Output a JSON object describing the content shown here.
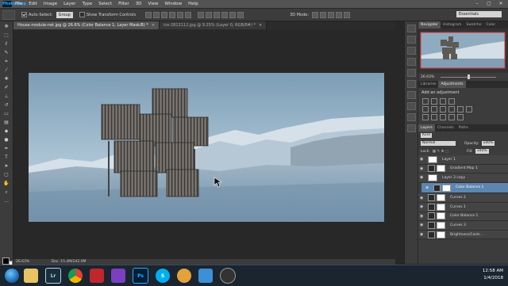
{
  "app": "Photoshop",
  "menu": [
    "File",
    "Edit",
    "Image",
    "Layer",
    "Type",
    "Select",
    "Filter",
    "3D",
    "View",
    "Window",
    "Help"
  ],
  "options": {
    "auto_select": "Auto-Select:",
    "auto_select_target": "Group",
    "transform_controls": "Show Transform Controls",
    "mode_3d": "3D Mode:",
    "workspace": "Essentials"
  },
  "tabs": [
    {
      "label": "House module-net.jpg @ 26.6% (Color Balance 1, Layer Mask/8) *",
      "close": "×"
    },
    {
      "label": "ice-2813112.jpg @ 9.25% (Layer 0, RGB/8#) *",
      "close": "×"
    }
  ],
  "status": {
    "zoom": "26.63%",
    "doc": "Doc: 15.4M/242.0M"
  },
  "navigator": {
    "tabs": [
      "Navigator",
      "Histogram",
      "Swatche",
      "Color"
    ],
    "zoom": "26.63%"
  },
  "adjustments": {
    "tabs": [
      "Libraries",
      "Adjustments"
    ],
    "title": "Add an adjustment"
  },
  "layers_panel": {
    "tabs": [
      "Layers",
      "Channels",
      "Paths"
    ],
    "kind": "Kind",
    "blend_mode": "Normal",
    "opacity_label": "Opacity:",
    "opacity": "100%",
    "lock_label": "Lock:",
    "fill_label": "Fill:",
    "fill": "100%",
    "layers": [
      {
        "name": "Layer 1",
        "type": "pixel",
        "selected": false
      },
      {
        "name": "Gradient Map 1",
        "type": "adjust",
        "selected": false
      },
      {
        "name": "Layer 3 copy",
        "type": "pixel",
        "selected": false
      },
      {
        "name": "Color Balance 1",
        "type": "adjust",
        "selected": true
      },
      {
        "name": "Curves 2",
        "type": "adjust",
        "selected": false
      },
      {
        "name": "Curves 1",
        "type": "adjust",
        "selected": false
      },
      {
        "name": "Color Balance 1",
        "type": "adjust",
        "selected": false
      },
      {
        "name": "Curves 3",
        "type": "adjust",
        "selected": false
      },
      {
        "name": "Brightness/Contr...",
        "type": "adjust",
        "selected": false
      }
    ]
  },
  "taskbar": {
    "apps": [
      {
        "icon": "explorer-icon",
        "label": ""
      },
      {
        "icon": "lightroom-icon",
        "label": "Lr"
      },
      {
        "icon": "chrome-icon",
        "label": ""
      },
      {
        "icon": "vivaldi-icon",
        "label": ""
      },
      {
        "icon": "app-v-icon",
        "label": ""
      },
      {
        "icon": "photoshop-icon",
        "label": "Ps"
      },
      {
        "icon": "skype-icon",
        "label": "S"
      },
      {
        "icon": "media-icon",
        "label": ""
      },
      {
        "icon": "screen-icon",
        "label": ""
      },
      {
        "icon": "camera-icon",
        "label": ""
      }
    ],
    "time": "12:58 AM",
    "date": "1/4/2018"
  }
}
